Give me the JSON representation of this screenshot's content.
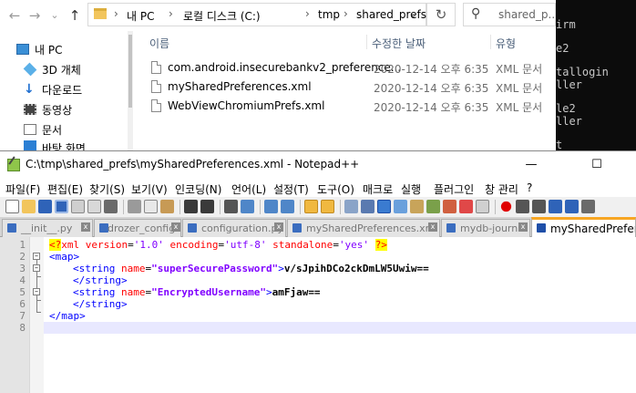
{
  "explorer": {
    "nav": {
      "back": "←",
      "forward": "→",
      "dropdown": "⌄",
      "up": "↑"
    },
    "breadcrumbs": [
      "내 PC",
      "로컬 디스크 (C:)",
      "tmp",
      "shared_prefs"
    ],
    "breadcrumb_sep": "›",
    "address_dropdown": "⌄",
    "refresh": "↻",
    "search": {
      "placeholder": "shared_p..."
    },
    "sidebar": [
      {
        "label": "내 PC",
        "icon": "computer-icon"
      },
      {
        "label": "3D 개체",
        "icon": "3d-objects-icon"
      },
      {
        "label": "다운로드",
        "icon": "download-icon"
      },
      {
        "label": "동영상",
        "icon": "video-icon"
      },
      {
        "label": "문서",
        "icon": "documents-icon"
      },
      {
        "label": "바탕 화면",
        "icon": "desktop-icon"
      }
    ],
    "columns": {
      "name": "이름",
      "date": "수정한 날짜",
      "type": "유형"
    },
    "files": [
      {
        "name": "com.android.insecurebankv2_preference...",
        "date": "2020-12-14 오후 6:35",
        "type": "XML 문서"
      },
      {
        "name": "mySharedPreferences.xml",
        "date": "2020-12-14 오후 6:35",
        "type": "XML 문서"
      },
      {
        "name": "WebViewChromiumPrefs.xml",
        "date": "2020-12-14 오후 6:35",
        "type": "XML 문서"
      }
    ]
  },
  "terminal": {
    "lines": [
      "irm",
      "",
      "e2",
      "",
      "tallogin",
      "ller",
      "",
      "le2",
      "ller",
      "",
      "t"
    ]
  },
  "notepad": {
    "title": "C:\\tmp\\shared_prefs\\mySharedPreferences.xml - Notepad++",
    "window_buttons": {
      "minimize": "—",
      "maximize": "☐",
      "close": "✕"
    },
    "menu": [
      "파일(F)",
      "편집(E)",
      "찾기(S)",
      "보기(V)",
      "인코딩(N)",
      "언어(L)",
      "설정(T)",
      "도구(O)",
      "매크로",
      "실행",
      "플러그인",
      "창 관리",
      "?"
    ],
    "tabs": [
      {
        "label": "__init__.py",
        "active": false
      },
      {
        "label": "drozer_config",
        "active": false
      },
      {
        "label": "configuration.py",
        "active": false
      },
      {
        "label": "mySharedPreferences.xml",
        "active": false
      },
      {
        "label": "mydb-journal",
        "active": false
      },
      {
        "label": "mySharedPreferer",
        "active": true
      }
    ],
    "tab_close": "x",
    "line_numbers": [
      "1",
      "2",
      "3",
      "4",
      "5",
      "6",
      "7",
      "8"
    ],
    "code": {
      "l1": {
        "pi_open": "<?",
        "tag": "xml",
        "a1": " version",
        "eq1": "=",
        "v1": "'1.0'",
        "a2": " encoding",
        "eq2": "=",
        "v2": "'utf-8'",
        "a3": " standalone",
        "eq3": "=",
        "v3": "'yes'",
        "sp": " ",
        "pi_close": "?>"
      },
      "l2": "<map>",
      "l3": {
        "open": "<string",
        "attr": " name",
        "eq": "=",
        "val": "\"superSecurePassword\"",
        "gt": ">",
        "text": "v/sJpihDCo2ckDmLW5Uwiw=="
      },
      "l4": "</string>",
      "l5": {
        "open": "<string",
        "attr": " name",
        "eq": "=",
        "val": "\"EncryptedUsername\"",
        "gt": ">",
        "text": "amFjaw=="
      },
      "l6": "</string>",
      "l7": "</map>"
    }
  }
}
